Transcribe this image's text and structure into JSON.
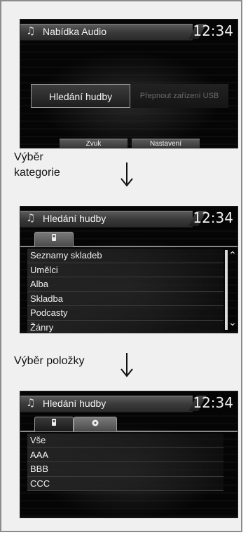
{
  "screen1": {
    "title": "Nabídka Audio",
    "clock": "12:34",
    "icon": "music-note-icon",
    "search_button": "Hledání hudby",
    "usb_button": "Přepnout zařízení USB",
    "tabs": [
      "Zvuk",
      "Nastavení"
    ]
  },
  "step1": {
    "line1": "Výběr",
    "line2": "kategorie"
  },
  "screen2": {
    "title": "Hledání hudby",
    "clock": "12:34",
    "tab_icon": "device-icon",
    "items": [
      "Seznamy skladeb",
      "Umělci",
      "Alba",
      "Skladba",
      "Podcasty",
      "Žánry"
    ]
  },
  "step2": {
    "label": "Výběr položky"
  },
  "screen3": {
    "title": "Hledání hudby",
    "clock": "12:34",
    "tab_icons": [
      "device-icon",
      "disc-icon"
    ],
    "items": [
      "Vše",
      "AAA",
      "BBB",
      "CCC"
    ]
  }
}
